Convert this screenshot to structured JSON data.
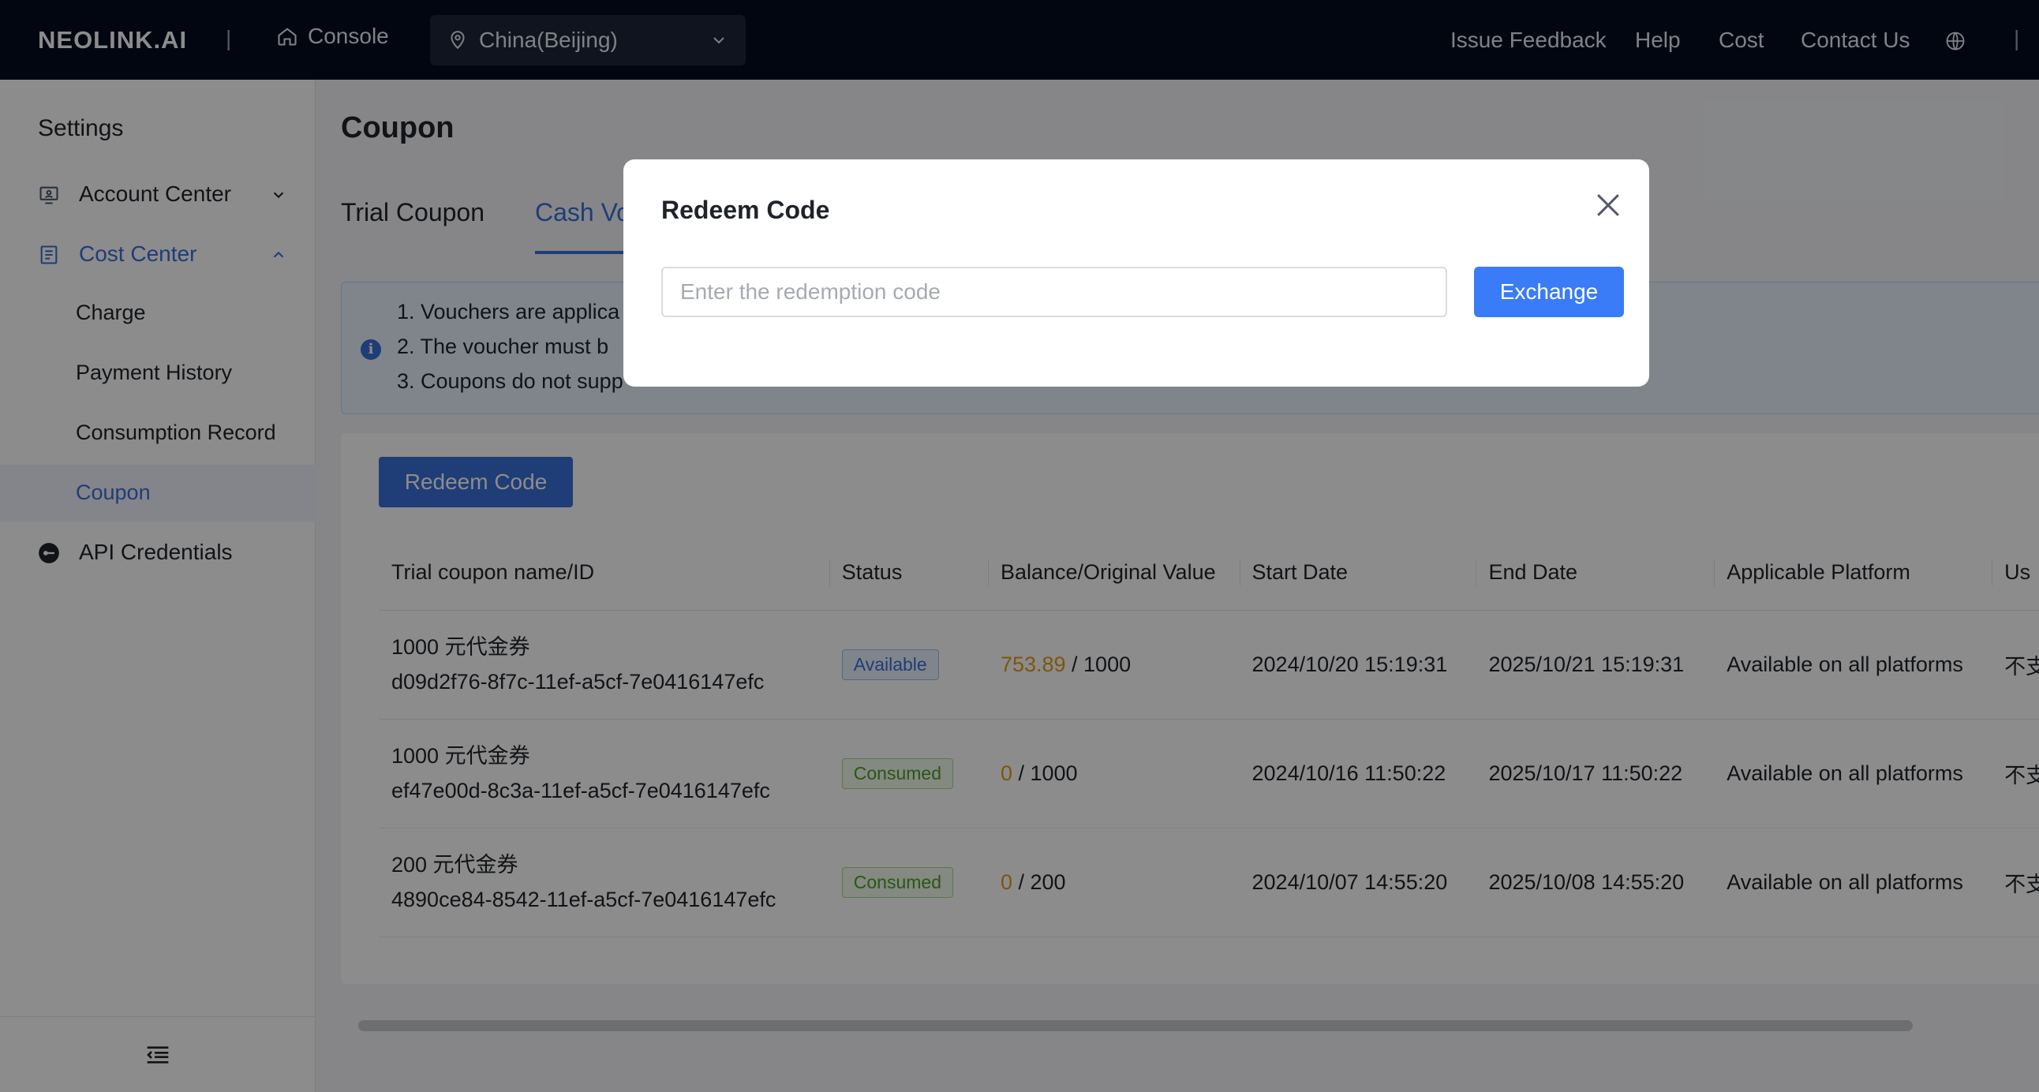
{
  "header": {
    "logo": "NEOLINK.AI",
    "divider": "|",
    "console_label": "Console",
    "region": "China(Beijing)",
    "links": [
      "Issue Feedback",
      "Help",
      "Cost",
      "Contact Us"
    ],
    "trailing_divider": "|"
  },
  "sidebar": {
    "title": "Settings",
    "account_center": "Account Center",
    "cost_center": "Cost Center",
    "sub_items": [
      "Charge",
      "Payment History",
      "Consumption Record",
      "Coupon"
    ],
    "api_credentials": "API Credentials"
  },
  "page": {
    "title": "Coupon",
    "tabs": [
      "Trial Coupon",
      "Cash Vo"
    ]
  },
  "notice": {
    "lines": [
      "1. Vouchers are applica",
      "2. The voucher must b",
      "3. Coupons do not supp"
    ]
  },
  "redeem_button": "Redeem Code",
  "table": {
    "headers": [
      "Trial coupon name/ID",
      "Status",
      "Balance/Original Value",
      "Start Date",
      "End Date",
      "Applicable Platform",
      "Us"
    ],
    "rows": [
      {
        "name": "1000 元代金券",
        "id": "d09d2f76-8f7c-11ef-a5cf-7e0416147efc",
        "status": "Available",
        "status_kind": "available",
        "balance": "753.89",
        "original": " / 1000",
        "start": "2024/10/20 15:19:31",
        "end": "2025/10/21 15:19:31",
        "platform": "Available on all platforms",
        "usage": "不支"
      },
      {
        "name": "1000 元代金券",
        "id": "ef47e00d-8c3a-11ef-a5cf-7e0416147efc",
        "status": "Consumed",
        "status_kind": "consumed",
        "balance": "0",
        "original": " / 1000",
        "start": "2024/10/16 11:50:22",
        "end": "2025/10/17 11:50:22",
        "platform": "Available on all platforms",
        "usage": "不支"
      },
      {
        "name": "200 元代金券",
        "id": "4890ce84-8542-11ef-a5cf-7e0416147efc",
        "status": "Consumed",
        "status_kind": "consumed",
        "balance": "0",
        "original": " / 200",
        "start": "2024/10/07 14:55:20",
        "end": "2025/10/08 14:55:20",
        "platform": "Available on all platforms",
        "usage": "不支"
      }
    ]
  },
  "modal": {
    "title": "Redeem Code",
    "input_placeholder": "Enter the redemption code",
    "input_value": "",
    "submit_label": "Exchange"
  },
  "colors": {
    "nav_bg": "#050b1f",
    "accent": "#3a6fd8",
    "balance_highlight": "#e59b1b",
    "available": "#3a6fd8",
    "consumed": "#4c9e2a"
  },
  "icons": [
    "home-icon",
    "location-pin-icon",
    "chevron-down-icon",
    "globe-icon",
    "monitor-user-icon",
    "receipt-icon",
    "chevron-up-icon",
    "key-icon",
    "info-icon",
    "collapse-menu-icon",
    "close-icon"
  ]
}
